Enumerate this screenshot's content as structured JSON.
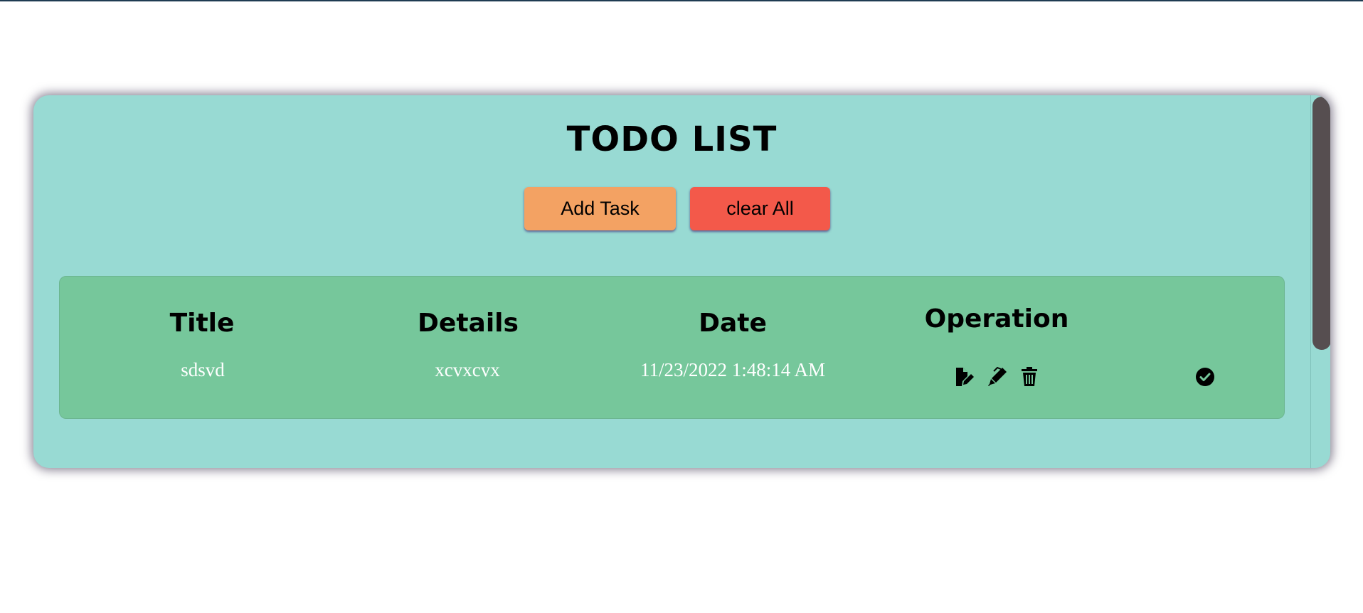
{
  "app": {
    "title": "TODO LIST"
  },
  "toolbar": {
    "add_label": "Add Task",
    "clear_label": "clear All"
  },
  "table": {
    "headers": {
      "title": "Title",
      "details": "Details",
      "date": "Date",
      "operation": "Operation"
    },
    "rows": [
      {
        "title": "sdsvd",
        "details": "xcvxcvx",
        "date": "11/23/2022 1:48:14 AM",
        "icons": [
          "edit-file-icon",
          "pen-icon",
          "trash-icon",
          "check-circle-icon"
        ]
      }
    ]
  },
  "colors": {
    "card_background": "#98dad3",
    "panel_background": "#76c79b",
    "add_button": "#f3a263",
    "clear_button": "#f3594a",
    "scroll_thumb": "#564e50"
  }
}
